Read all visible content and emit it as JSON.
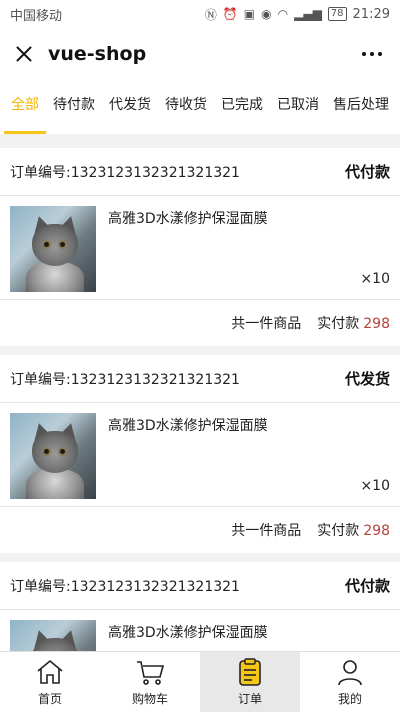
{
  "status_bar": {
    "carrier": "中国移动",
    "battery": "78",
    "time": "21:29"
  },
  "header": {
    "title": "vue-shop"
  },
  "tabs": [
    {
      "label": "全部",
      "active": true
    },
    {
      "label": "待付款",
      "active": false
    },
    {
      "label": "代发货",
      "active": false
    },
    {
      "label": "待收货",
      "active": false
    },
    {
      "label": "已完成",
      "active": false
    },
    {
      "label": "已取消",
      "active": false
    },
    {
      "label": "售后处理",
      "active": false
    }
  ],
  "orders": [
    {
      "order_no": "订单编号:1323123132321321321",
      "status": "代付款",
      "product": "高雅3D水漾修护保湿面膜",
      "qty": "×10",
      "count_text": "共一件商品",
      "pay_label": "实付款",
      "price": "298"
    },
    {
      "order_no": "订单编号:1323123132321321321",
      "status": "代发货",
      "product": "高雅3D水漾修护保湿面膜",
      "qty": "×10",
      "count_text": "共一件商品",
      "pay_label": "实付款",
      "price": "298"
    },
    {
      "order_no": "订单编号:1323123132321321321",
      "status": "代付款",
      "product": "高雅3D水漾修护保湿面膜",
      "qty": "",
      "count_text": "",
      "pay_label": "",
      "price": ""
    }
  ],
  "bottom_nav": [
    {
      "label": "首页",
      "icon": "home-icon",
      "active": false
    },
    {
      "label": "购物车",
      "icon": "cart-icon",
      "active": false
    },
    {
      "label": "订单",
      "icon": "order-icon",
      "active": true
    },
    {
      "label": "我的",
      "icon": "user-icon",
      "active": false
    }
  ],
  "colors": {
    "accent": "#f5c518",
    "price": "#b5413a"
  }
}
